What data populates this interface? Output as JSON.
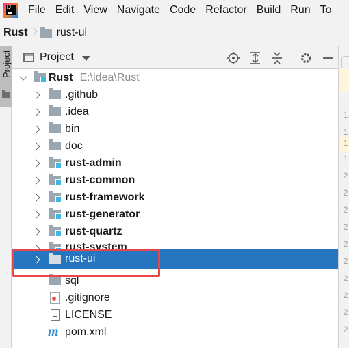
{
  "menubar": {
    "items": [
      {
        "label": "File",
        "mnemonic": "F",
        "rest": "ile"
      },
      {
        "label": "Edit",
        "mnemonic": "E",
        "rest": "dit"
      },
      {
        "label": "View",
        "mnemonic": "V",
        "rest": "iew"
      },
      {
        "label": "Navigate",
        "mnemonic": "N",
        "rest": "avigate"
      },
      {
        "label": "Code",
        "mnemonic": "C",
        "rest": "ode"
      },
      {
        "label": "Refactor",
        "mnemonic": "R",
        "rest": "efactor"
      },
      {
        "label": "Build",
        "mnemonic": "B",
        "rest": "uild"
      },
      {
        "label": "Run",
        "mnemonic": "u",
        "pre": "R",
        "rest": "n"
      },
      {
        "label": "To",
        "mnemonic": "T",
        "rest": "o"
      }
    ]
  },
  "breadcrumb": {
    "root": "Rust",
    "current": "rust-ui"
  },
  "tool_strip": {
    "tab_label": "Project"
  },
  "project_panel": {
    "title": "Project",
    "tools": [
      "locate-icon",
      "expand-all-icon",
      "collapse-all-icon",
      "gear-icon",
      "hide-icon"
    ],
    "tree": [
      {
        "name": "Rust",
        "path": "E:\\idea\\Rust",
        "icon": "module-folder",
        "expanded": true,
        "bold": true,
        "level": 0
      },
      {
        "name": ".github",
        "icon": "folder",
        "level": 1
      },
      {
        "name": ".idea",
        "icon": "folder",
        "level": 1
      },
      {
        "name": "bin",
        "icon": "folder",
        "level": 1
      },
      {
        "name": "doc",
        "icon": "folder",
        "level": 1
      },
      {
        "name": "rust-admin",
        "icon": "module-folder",
        "bold": true,
        "level": 1
      },
      {
        "name": "rust-common",
        "icon": "module-folder",
        "bold": true,
        "level": 1
      },
      {
        "name": "rust-framework",
        "icon": "module-folder",
        "bold": true,
        "level": 1
      },
      {
        "name": "rust-generator",
        "icon": "module-folder",
        "bold": true,
        "level": 1
      },
      {
        "name": "rust-quartz",
        "icon": "module-folder",
        "bold": true,
        "level": 1
      },
      {
        "name": "rust-system",
        "icon": "module-folder",
        "bold": true,
        "level": 1
      },
      {
        "name": "rust-ui",
        "icon": "folder",
        "selected": true,
        "level": 1
      },
      {
        "name": "sql",
        "icon": "folder",
        "level": 1
      },
      {
        "name": ".gitignore",
        "icon": "git-file",
        "level": 1
      },
      {
        "name": "LICENSE",
        "icon": "text-file",
        "level": 1
      },
      {
        "name": "pom.xml",
        "icon": "maven-file",
        "level": 1
      }
    ]
  },
  "gutter": {
    "line_numbers": [
      "1",
      "1",
      "1",
      "1",
      "2",
      "2",
      "2",
      "2",
      "2",
      "2",
      "2",
      "2",
      "2",
      "2"
    ]
  },
  "colors": {
    "selection": "#2675bf",
    "annotation": "#e8464b",
    "module_badge": "#40b6e0",
    "folder": "#9aa7b0"
  }
}
